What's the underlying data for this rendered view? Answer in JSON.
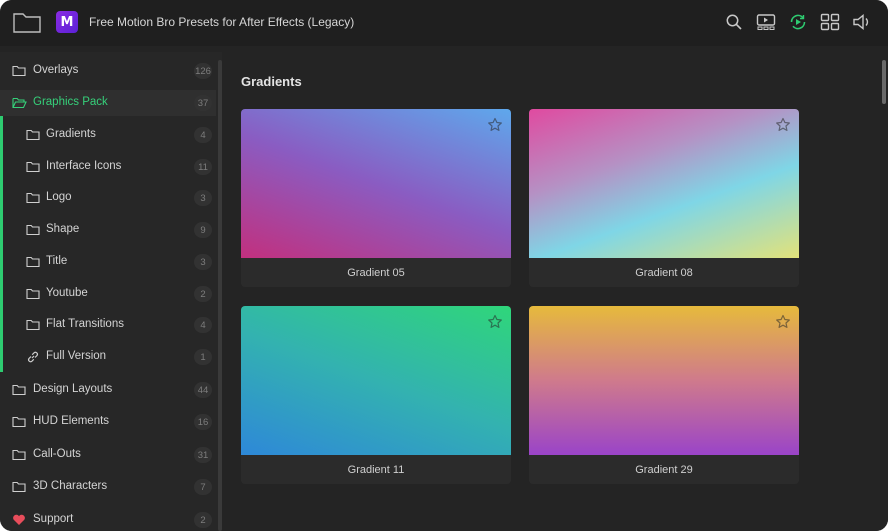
{
  "app": {
    "title": "Free Motion Bro Presets for After Effects (Legacy)",
    "logo_letter": "M"
  },
  "header_icons": [
    "search-icon",
    "video-library-icon",
    "play-refresh-icon",
    "grid-view-icon",
    "volume-icon"
  ],
  "colors": {
    "accent": "#2ecc71",
    "background": "#242424",
    "header": "#1f1f1f",
    "sidebar": "#272727"
  },
  "sidebar": {
    "items": [
      {
        "label": "Overlays",
        "count": "126",
        "icon": "folder-icon"
      },
      {
        "label": "Graphics Pack",
        "count": "37",
        "icon": "folder-open-icon",
        "active": true
      },
      {
        "label": "Gradients",
        "count": "4",
        "icon": "folder-icon"
      },
      {
        "label": "Interface Icons",
        "count": "11",
        "icon": "folder-icon"
      },
      {
        "label": "Logo",
        "count": "3",
        "icon": "folder-icon"
      },
      {
        "label": "Shape",
        "count": "9",
        "icon": "folder-icon"
      },
      {
        "label": "Title",
        "count": "3",
        "icon": "folder-icon"
      },
      {
        "label": "Youtube",
        "count": "2",
        "icon": "folder-icon"
      },
      {
        "label": "Flat Transitions",
        "count": "4",
        "icon": "folder-icon"
      },
      {
        "label": "Full Version",
        "count": "1",
        "icon": "link-icon"
      },
      {
        "label": "Design Layouts",
        "count": "44",
        "icon": "folder-icon"
      },
      {
        "label": "HUD Elements",
        "count": "16",
        "icon": "folder-icon"
      },
      {
        "label": "Call-Outs",
        "count": "31",
        "icon": "folder-icon"
      },
      {
        "label": "3D Characters",
        "count": "7",
        "icon": "folder-icon"
      },
      {
        "label": "Support",
        "count": "2",
        "icon": "heart-icon"
      }
    ]
  },
  "main": {
    "section_title": "Gradients",
    "cards": [
      {
        "name": "Gradient 05",
        "gradient": [
          "#c2307e",
          "#8a5cc2",
          "#5ea8ec"
        ]
      },
      {
        "name": "Gradient 08",
        "gradient": [
          "#e04aa0",
          "#7fd6e6",
          "#e2e27a"
        ]
      },
      {
        "name": "Gradient 11",
        "gradient": [
          "#2fd67a",
          "#33b2b0",
          "#2e88d8"
        ]
      },
      {
        "name": "Gradient 29",
        "gradient": [
          "#e6ba3c",
          "#cf7a8c",
          "#9a44c8"
        ]
      }
    ]
  }
}
